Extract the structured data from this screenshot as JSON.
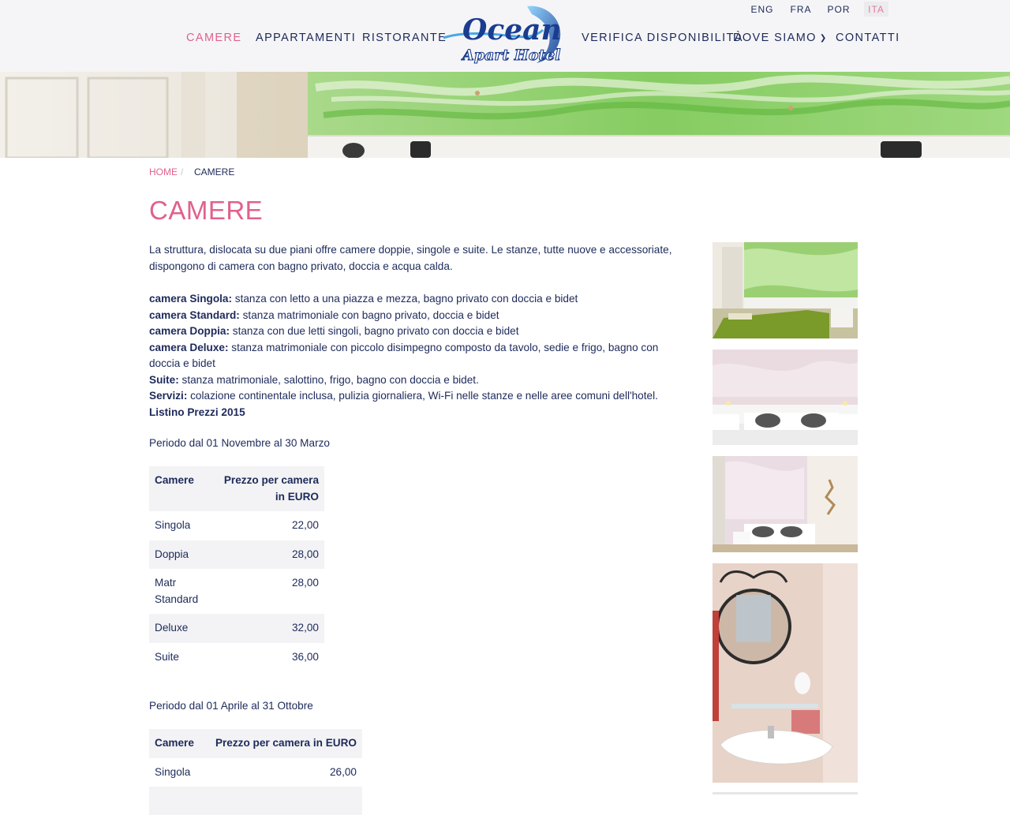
{
  "languages": [
    {
      "label": "ENG",
      "active": false
    },
    {
      "label": "FRA",
      "active": false
    },
    {
      "label": "POR",
      "active": false
    },
    {
      "label": "ITA",
      "active": true
    }
  ],
  "nav": {
    "camere": "CAMERE",
    "appartamenti": "APPARTAMENTI",
    "ristorante": "RISTORANTE",
    "verifica": "VERIFICA DISPONIBILITÀ",
    "dove_siamo": "DOVE SIAMO",
    "contatti": "CONTATTI",
    "active": "camere"
  },
  "logo": {
    "line1": "Ocean",
    "line2": "Apart Hotel"
  },
  "breadcrumb": {
    "home": "HOME",
    "separator": "/",
    "current": "CAMERE"
  },
  "page_title": "CAMERE",
  "intro": "La struttura, dislocata su due piani offre camere doppie, singole e suite. Le stanze, tutte nuove e accessoriate, dispongono di camera con bagno privato, doccia e acqua calda.",
  "rooms": [
    {
      "label": "camera Singola:",
      "desc": " stanza con letto a una piazza e mezza, bagno privato con doccia e bidet"
    },
    {
      "label": "camera Standard:",
      "desc": " stanza matrimoniale con bagno privato, doccia e bidet"
    },
    {
      "label": "camera Doppia:",
      "desc": " stanza con due letti singoli, bagno privato con doccia e bidet"
    },
    {
      "label": "camera Deluxe:",
      "desc": " stanza matrimoniale con piccolo disimpegno composto da tavolo, sedie e frigo, bagno con doccia e bidet"
    },
    {
      "label": "Suite:",
      "desc": " stanza matrimoniale, salottino, frigo, bagno con doccia e bidet."
    },
    {
      "label": "Servizi:",
      "desc": " colazione continentale inclusa, pulizia giornaliera, Wi-Fi nelle stanze e nelle aree comuni dell'hotel."
    }
  ],
  "price_list_title": "Listino Prezzi 2015",
  "period1": {
    "label": "Periodo dal 01 Novembre al 30 Marzo",
    "headers": [
      "Camere",
      "Prezzo per camera in EURO"
    ],
    "rows": [
      [
        "Singola",
        "22,00"
      ],
      [
        "Doppia",
        "28,00"
      ],
      [
        "Matr Standard",
        "28,00"
      ],
      [
        "Deluxe",
        "32,00"
      ],
      [
        "Suite",
        "36,00"
      ]
    ]
  },
  "period2": {
    "label": "Periodo dal 01 Aprile al 31 Ottobre",
    "headers": [
      "Camere",
      "Prezzo per camera in EURO"
    ],
    "rows": [
      [
        "Singola",
        "26,00"
      ]
    ]
  },
  "colors": {
    "accent": "#e0628c",
    "text": "#1d2a5a",
    "header_bg": "#f5f5f7",
    "logo_blue": "#1a3d8f"
  },
  "gallery": [
    "green-room-photo",
    "pink-room-photo",
    "double-bed-room-photo",
    "bathroom-mirror-photo"
  ]
}
